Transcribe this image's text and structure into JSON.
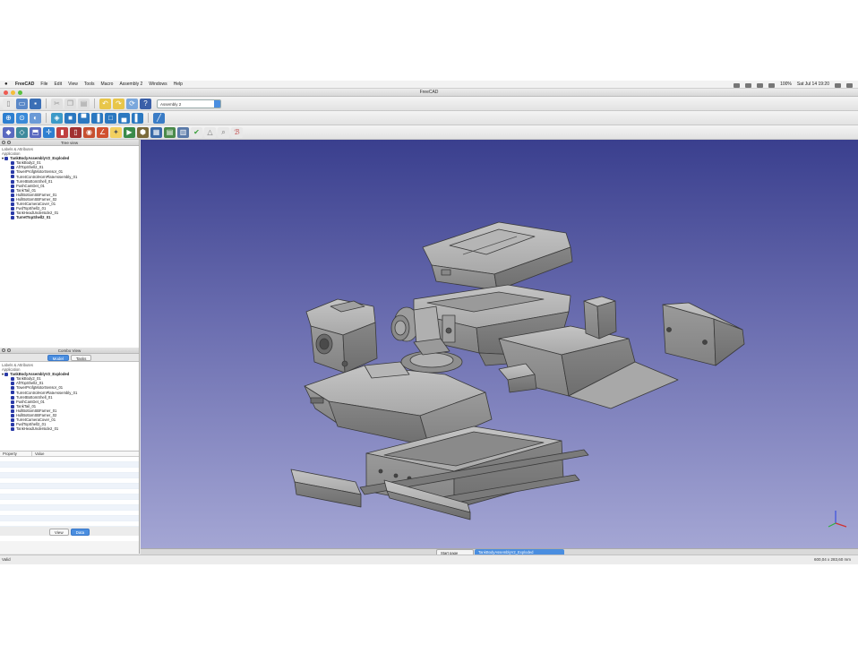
{
  "menubar": {
    "app_name": "FreeCAD",
    "menus": [
      "File",
      "Edit",
      "View",
      "Tools",
      "Macro",
      "Assembly 2",
      "Windows",
      "Help"
    ],
    "battery": "100%",
    "clock": "Sat Jul 14  19:20"
  },
  "window": {
    "title": "FreeCAD"
  },
  "toolbar": {
    "workbench_selector": "Assembly 2"
  },
  "tree_view": {
    "title": "Tree view",
    "caption_labels": "Labels & Attributes",
    "caption_app": "Application",
    "root": "TankBodyAssemblyV2_Exploded",
    "items": [
      "TankBody2_01",
      "AftTopShell2_01",
      "TowerProfgMotorSensor_01",
      "TurretControlHornPlateAssembly_01",
      "TurretBottomShell_01",
      "PushCamDet_01",
      "TankTail_01",
      "HullBottomSBFarner_01",
      "HullBottomSBFarner_02",
      "TurretCameraCover_01",
      "FwdTopShell2_01",
      "TankHeadUnderside2_01"
    ],
    "last_item": "TurretTopShell2_01"
  },
  "combo_view": {
    "title": "Combo View",
    "tabs": [
      "Model",
      "Tasks"
    ],
    "caption_labels": "Labels & Attributes",
    "caption_app": "Application",
    "root": "TankBodyAssemblyV2_Exploded",
    "items": [
      "TankBody2_01",
      "AftTopShell2_01",
      "TowerProfgMotorSensor_01",
      "TurretControlHornPlateAssembly_01",
      "TurretBottomShell_01",
      "PushCamDet_01",
      "TankTail_01",
      "HullBottomSBFarner_01",
      "HullBottomSBFarner_02",
      "TurretCameraCover_01",
      "FwdTopShell2_01",
      "TankHeadUnderside2_01"
    ],
    "property_col": "Property",
    "value_col": "Value",
    "bottom_tabs": [
      "View",
      "Data"
    ]
  },
  "doc_tabs": [
    "Start page",
    "TankBodyAssemblyV2_Exploded"
  ],
  "status": {
    "left": "Valid",
    "right": "600,04 x 283,60 mm"
  },
  "colors": {
    "viewport_top": "#3a3f8e",
    "viewport_bottom": "#a4a6d4",
    "accent": "#4a8ee0",
    "part": "#9c9c9c"
  }
}
